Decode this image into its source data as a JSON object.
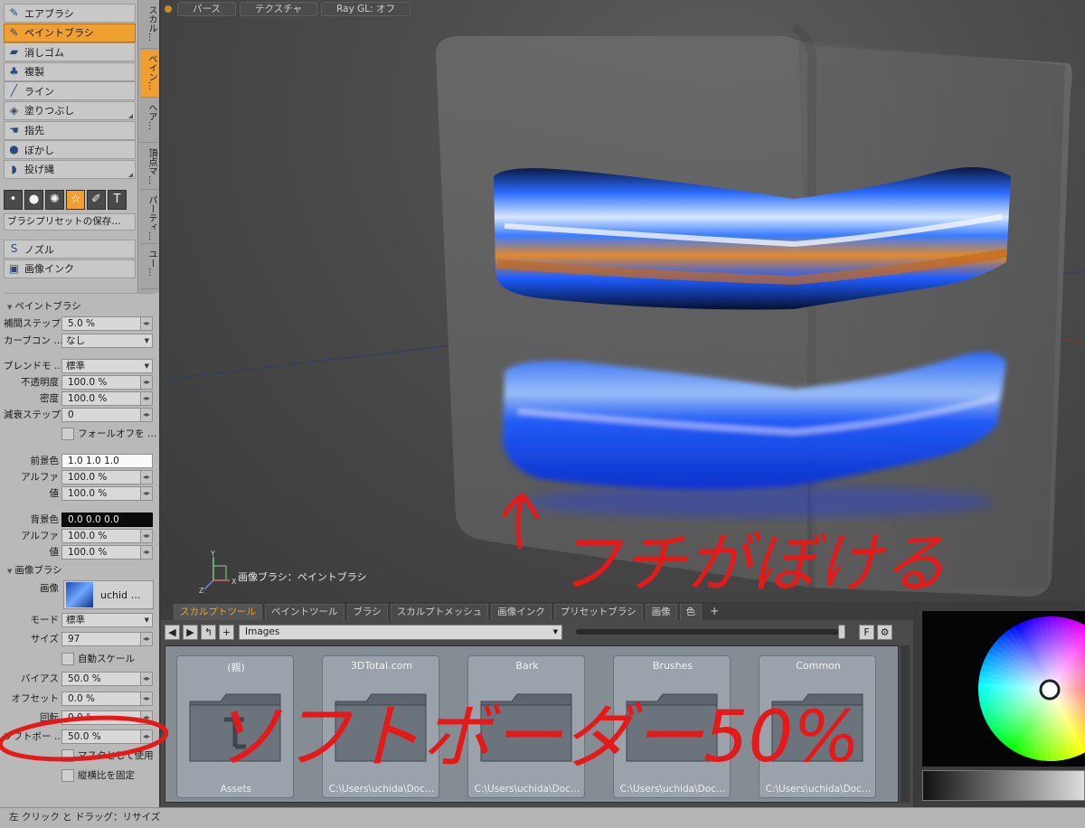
{
  "vertical_tabs": [
    "スカル…",
    "ペイン…",
    "ヘア…",
    "頂点マ…",
    "パーティ…",
    "ユー…"
  ],
  "tools": [
    {
      "label": "エアブラシ",
      "icon": "airbrush-icon",
      "glyph": "✎",
      "active": false
    },
    {
      "label": "ペイントブラシ",
      "icon": "paintbrush-icon",
      "glyph": "✎",
      "active": true
    },
    {
      "label": "消しゴム",
      "icon": "eraser-icon",
      "glyph": "▰",
      "active": false
    },
    {
      "label": "複製",
      "icon": "clone-icon",
      "glyph": "♣",
      "active": false
    },
    {
      "label": "ライン",
      "icon": "line-icon",
      "glyph": "╱",
      "active": false
    },
    {
      "label": "塗りつぶし",
      "icon": "fill-icon",
      "glyph": "◈",
      "active": false
    },
    {
      "label": "指先",
      "icon": "smudge-icon",
      "glyph": "☚",
      "active": false
    },
    {
      "label": "ぼかし",
      "icon": "blur-icon",
      "glyph": "●",
      "active": false
    },
    {
      "label": "投げ縄",
      "icon": "lasso-icon",
      "glyph": "◗",
      "active": false
    }
  ],
  "brush_shapes": [
    {
      "icon": "soft-brush-icon",
      "glyph": "•",
      "active": false
    },
    {
      "icon": "hard-brush-icon",
      "glyph": "●",
      "active": false
    },
    {
      "icon": "splatter-brush-icon",
      "glyph": "✺",
      "active": false
    },
    {
      "icon": "star-brush-icon",
      "glyph": "☆",
      "active": true
    },
    {
      "icon": "custom-brush-icon",
      "glyph": "✐",
      "active": false
    },
    {
      "icon": "text-brush-icon",
      "glyph": "T",
      "active": false
    }
  ],
  "brush_preset_save": "ブラシプリセットの保存…",
  "tools2": [
    {
      "label": "ノズル",
      "icon": "nozzle-icon",
      "glyph": "S"
    },
    {
      "label": "画像インク",
      "icon": "image-ink-icon",
      "glyph": "▣"
    }
  ],
  "paintbrush_section": {
    "title": "ペイントブラシ",
    "spacing_label": "補間ステップ",
    "spacing_value": "5.0 %",
    "curve_label": "カーブコン …",
    "curve_value": "なし",
    "blend_label": "ブレンドモ …",
    "blend_value": "標準",
    "opacity_label": "不透明度",
    "opacity_value": "100.0 %",
    "density_label": "密度",
    "density_value": "100.0 %",
    "falloff_steps_label": "減衰ステップ",
    "falloff_steps_value": "0",
    "falloff_check_label": "フォールオフを …",
    "fg_label": "前景色",
    "fg_value": "1.0  1.0  1.0",
    "fg_alpha_label": "アルファ",
    "fg_alpha_value": "100.0 %",
    "fg_val_label": "値",
    "fg_val_value": "100.0 %",
    "bg_label": "背景色",
    "bg_value": "0.0  0.0  0.0",
    "bg_alpha_label": "アルファ",
    "bg_alpha_value": "100.0 %",
    "bg_val_label": "値",
    "bg_val_value": "100.0 %"
  },
  "image_brush_section": {
    "title": "画像ブラシ",
    "image_label": "画像",
    "image_name": "uchid …",
    "mode_label": "モード",
    "mode_value": "標準",
    "size_label": "サイズ",
    "size_value": "97",
    "autoscale_label": "自動スケール",
    "bias_label": "バイアス",
    "bias_value": "50.0 %",
    "offset_label": "オフセット",
    "offset_value": "0.0 %",
    "rotate_label": "回転",
    "rotate_value": "0.0 °",
    "softborder_label": "ソフトボー …",
    "softborder_value": "50.0 %",
    "mask_label": "マスクとして使用",
    "aspect_label": "縦横比を固定"
  },
  "viewport": {
    "buttons": [
      "パース",
      "テクスチャ",
      "Ray GL: オフ"
    ],
    "status": "画像ブラシ：ペイントブラシ"
  },
  "browser": {
    "tabs": [
      {
        "label": "スカルプトツール",
        "active": true
      },
      {
        "label": "ペイントツール",
        "active": false
      },
      {
        "label": "ブラシ",
        "active": false
      },
      {
        "label": "スカルプトメッシュ",
        "active": false
      },
      {
        "label": "画像インク",
        "active": false
      },
      {
        "label": "プリセットブラシ",
        "active": false
      },
      {
        "label": "画像",
        "active": false
      },
      {
        "label": "色",
        "active": false
      }
    ],
    "add_tab": "+",
    "path": "Images",
    "filter_button": "F",
    "folders": [
      {
        "title": "(親)",
        "caption": "Assets"
      },
      {
        "title": "3DTotal.com",
        "caption": "C:\\Users\\uchida\\Doc…"
      },
      {
        "title": "Bark",
        "caption": "C:\\Users\\uchida\\Doc…"
      },
      {
        "title": "Brushes",
        "caption": "C:\\Users\\uchida\\Doc…"
      },
      {
        "title": "Common",
        "caption": "C:\\Users\\uchida\\Doc…"
      }
    ]
  },
  "statusbar": "左 クリック と ドラッグ：リサイズ",
  "annotations": {
    "edge_blur": "フチがぼける",
    "soft_border": "ソフトボーダー50%"
  },
  "colors": {
    "accent": "#f0a030",
    "annotation_red": "#e41a1a",
    "panel": "#b9b9b9",
    "paint_blue": "#1e5cff",
    "paint_orange": "#e08a30"
  }
}
